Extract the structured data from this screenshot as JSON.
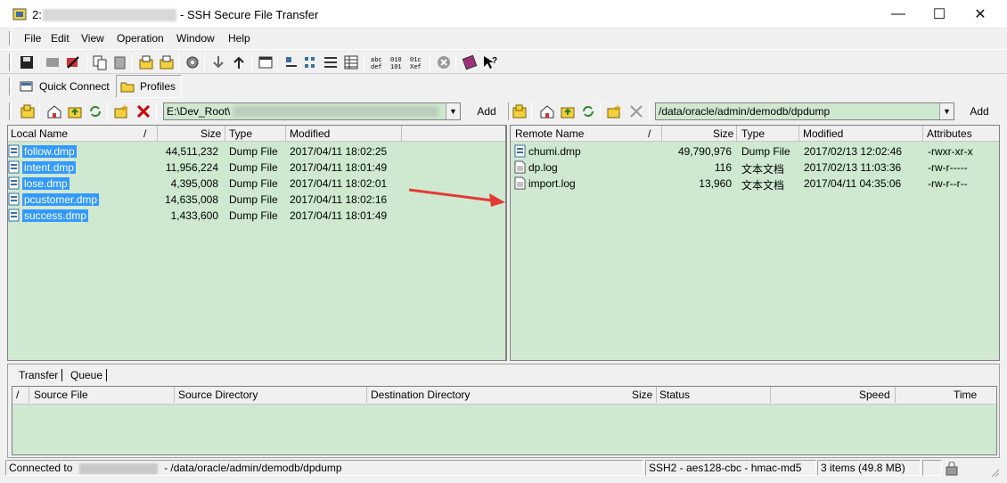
{
  "window": {
    "host_prefix": "2:",
    "title": "- SSH Secure File Transfer",
    "minimize": "—",
    "maximize": "☐",
    "close": "✕"
  },
  "menu": [
    "File",
    "Edit",
    "View",
    "Operation",
    "Window",
    "Help"
  ],
  "quickbar": {
    "quick_connect": "Quick Connect",
    "profiles": "Profiles"
  },
  "local": {
    "path": "E:\\Dev_Root\\",
    "add_label": "Add",
    "columns": {
      "name": "Local Name",
      "sort": "/",
      "size": "Size",
      "type": "Type",
      "modified": "Modified"
    },
    "files": [
      {
        "name": "follow.dmp",
        "size": "44,511,232",
        "type": "Dump File",
        "modified": "2017/04/11 18:02:25"
      },
      {
        "name": "intent.dmp",
        "size": "11,956,224",
        "type": "Dump File",
        "modified": "2017/04/11 18:01:49"
      },
      {
        "name": "lose.dmp",
        "size": "4,395,008",
        "type": "Dump File",
        "modified": "2017/04/11 18:02:01"
      },
      {
        "name": "pcustomer.dmp",
        "size": "14,635,008",
        "type": "Dump File",
        "modified": "2017/04/11 18:02:16"
      },
      {
        "name": "success.dmp",
        "size": "1,433,600",
        "type": "Dump File",
        "modified": "2017/04/11 18:01:49"
      }
    ]
  },
  "remote": {
    "path": "/data/oracle/admin/demodb/dpdump",
    "add_label": "Add",
    "columns": {
      "name": "Remote Name",
      "sort": "/",
      "size": "Size",
      "type": "Type",
      "modified": "Modified",
      "attributes": "Attributes"
    },
    "files": [
      {
        "name": "chumi.dmp",
        "size": "49,790,976",
        "type": "Dump File",
        "modified": "2017/02/13 12:02:46",
        "attributes": "-rwxr-xr-x"
      },
      {
        "name": "dp.log",
        "size": "116",
        "type": "文本文档",
        "modified": "2017/02/13 11:03:36",
        "attributes": "-rw-r-----"
      },
      {
        "name": "import.log",
        "size": "13,960",
        "type": "文本文档",
        "modified": "2017/04/11 04:35:06",
        "attributes": "-rw-r--r--"
      }
    ]
  },
  "transfer": {
    "tabs": [
      "Transfer",
      "Queue"
    ],
    "columns": {
      "sort": "/",
      "source_file": "Source File",
      "source_dir": "Source Directory",
      "dest_dir": "Destination Directory",
      "size": "Size",
      "status": "Status",
      "speed": "Speed",
      "time": "Time"
    }
  },
  "status": {
    "connected": "Connected to",
    "path": "- /data/oracle/admin/demodb/dpdump",
    "cipher": "SSH2 - aes128-cbc - hmac-md5",
    "items": "3 items (49.8 MB)"
  },
  "colors": {
    "pane_bg": "#cfe8d0",
    "selection": "#3399ff",
    "arrow": "#e53935"
  }
}
